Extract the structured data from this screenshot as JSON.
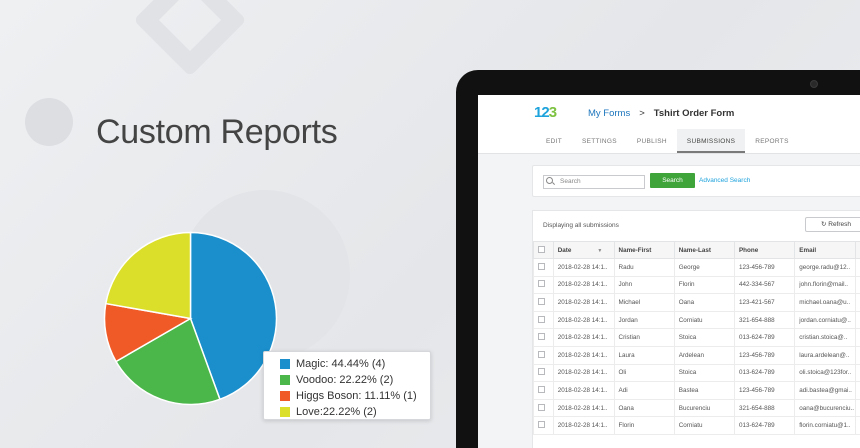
{
  "headline": "Custom Reports",
  "chart_data": {
    "type": "pie",
    "slices": [
      {
        "label": "Magic",
        "value": 44.44,
        "count": 4,
        "color": "#1a8fcc"
      },
      {
        "label": "Voodoo",
        "value": 22.22,
        "count": 2,
        "color": "#4bb64a"
      },
      {
        "label": "Higgs Boson",
        "value": 11.11,
        "count": 1,
        "color": "#ef5a26"
      },
      {
        "label": "Love",
        "value": 22.22,
        "count": 2,
        "color": "#dbdf29"
      }
    ],
    "legend": [
      "Magic: 44.44% (4)",
      "Voodoo: 22.22% (2)",
      "Higgs Boson: 11.11% (1)",
      "Love:22.22% (2)"
    ]
  },
  "app": {
    "logo_part1": "12",
    "logo_part2": "3",
    "breadcrumb_link": "My Forms",
    "breadcrumb_sep": ">",
    "form_title": "Tshirt Order Form",
    "tabs": [
      "EDIT",
      "SETTINGS",
      "PUBLISH",
      "SUBMISSIONS",
      "REPORTS"
    ],
    "active_tab": "SUBMISSIONS",
    "search_placeholder": "Search",
    "search_button": "Search",
    "advanced_search": "Advanced Search",
    "displaying": "Displaying all submissions",
    "refresh": "Refresh"
  },
  "table": {
    "headers": [
      "Date",
      "Name-First",
      "Name-Last",
      "Phone",
      "Email",
      "I"
    ],
    "rows": [
      [
        "2018-02-28 14:1..",
        "Radu",
        "George",
        "123-456-789",
        "george.radu@12.."
      ],
      [
        "2018-02-28 14:1..",
        "John",
        "Florin",
        "442-334-567",
        "john.florin@mail.."
      ],
      [
        "2018-02-28 14:1..",
        "Michael",
        "Oana",
        "123-421-567",
        "michael.oana@u.."
      ],
      [
        "2018-02-28 14:1..",
        "Jordan",
        "Corniatu",
        "321-654-888",
        "jordan.corniatu@.."
      ],
      [
        "2018-02-28 14:1..",
        "Cristian",
        "Stoica",
        "013-624-789",
        "cristian.stoica@.."
      ],
      [
        "2018-02-28 14:1..",
        "Laura",
        "Ardelean",
        "123-456-789",
        "laura.ardelean@.."
      ],
      [
        "2018-02-28 14:1..",
        "Oli",
        "Stoica",
        "013-624-789",
        "oli.stoica@123for.."
      ],
      [
        "2018-02-28 14:1..",
        "Adi",
        "Bastea",
        "123-456-789",
        "adi.bastea@gmai.."
      ],
      [
        "2018-02-28 14:1..",
        "Oana",
        "Bucurenciu",
        "321-654-888",
        "oana@bucurenciu.."
      ],
      [
        "2018-02-28 14:1..",
        "Florin",
        "Corniatu",
        "013-624-789",
        "florin.corniatu@1.."
      ]
    ]
  }
}
